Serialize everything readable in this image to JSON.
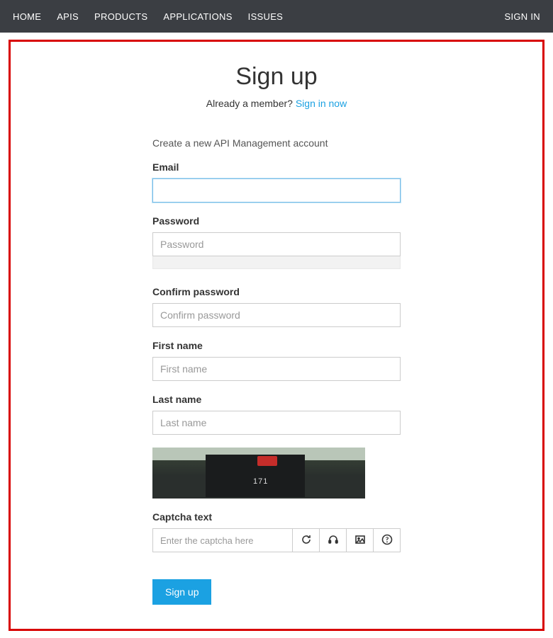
{
  "nav": {
    "left": [
      "HOME",
      "APIS",
      "PRODUCTS",
      "APPLICATIONS",
      "ISSUES"
    ],
    "right": "SIGN IN"
  },
  "page": {
    "title": "Sign up",
    "subtitle_prefix": "Already a member? ",
    "subtitle_link": "Sign in now"
  },
  "form": {
    "desc": "Create a new API Management account",
    "email_label": "Email",
    "email_value": "",
    "password_label": "Password",
    "password_placeholder": "Password",
    "confirm_label": "Confirm password",
    "confirm_placeholder": "Confirm password",
    "first_label": "First name",
    "first_placeholder": "First name",
    "last_label": "Last name",
    "last_placeholder": "Last name",
    "captcha_label": "Captcha text",
    "captcha_placeholder": "Enter the captcha here",
    "captcha_image_text": "171",
    "submit_label": "Sign up"
  },
  "colors": {
    "accent": "#1ba1e2",
    "navbar": "#3b3e43",
    "highlight_border": "#d80000"
  }
}
